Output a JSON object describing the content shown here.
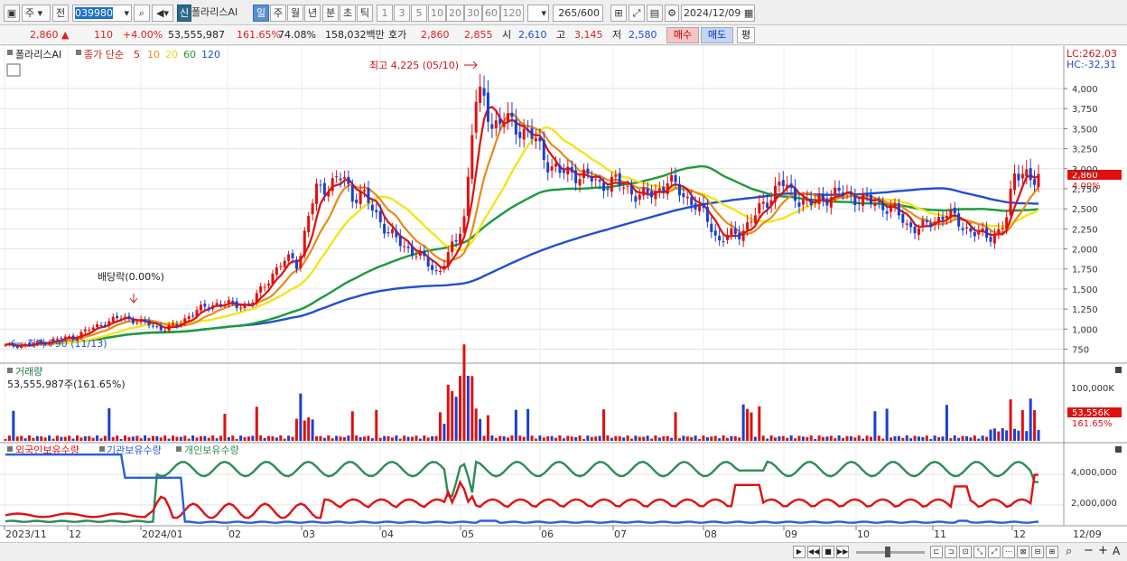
{
  "toolbar": {
    "market": "주",
    "prev_label": "전",
    "code": "039980",
    "new_label": "신",
    "name": "폴라리스AI",
    "periods": [
      "일",
      "주",
      "월",
      "년",
      "분",
      "초",
      "틱"
    ],
    "active_period": "일",
    "intervals": [
      "1",
      "3",
      "5",
      "10",
      "20",
      "30",
      "60",
      "120"
    ],
    "count": "265",
    "count_max": "/600",
    "date": "2024/12/09"
  },
  "quote": {
    "price": "2,860",
    "change": "110",
    "change_pct": "+4.00%",
    "volume": "53,555,987",
    "volume_ratio": "161.65%",
    "turnover_pct": "74.08%",
    "amount": "158,032백만",
    "bid_label": "호가",
    "ask": "2,860",
    "bid": "2,855",
    "open_label": "시",
    "open": "2,610",
    "high_label": "고",
    "high": "3,145",
    "low_label": "저",
    "low": "2,580",
    "buy_label": "매수",
    "sell_label": "매도",
    "flat_label": "평"
  },
  "price_panel": {
    "stock_label": "폴라리스AI",
    "ma_title": "종가 단순",
    "ma_periods": [
      "5",
      "10",
      "20",
      "60",
      "120"
    ],
    "lc": "LC:262,03",
    "hc": "HC:-32,31",
    "max_label": "최고 4,225 (05/10)",
    "min_label": "최저 790 (11/13)",
    "dividend_label": "배당락(0.00%)",
    "current_price_tag": "2,860",
    "current_pct_tag": "4.00%"
  },
  "volume_panel": {
    "title": "거래량",
    "value": "53,555,987주(161.65%)",
    "axis_label": "100,000K",
    "tag": "53,556K",
    "tag_pct": "161.65%"
  },
  "holding_panel": {
    "legend": [
      "외국인보유수량",
      "기관보유수량",
      "개인보유수량"
    ],
    "colors": [
      "#e01010",
      "#2a5fd6",
      "#2e8b57"
    ]
  },
  "xaxis": {
    "labels": [
      "2023/11",
      "12",
      "2024/01",
      "02",
      "03",
      "04",
      "05",
      "06",
      "07",
      "08",
      "09",
      "10",
      "11",
      "12"
    ],
    "end_label": "12/09"
  },
  "chart_data": {
    "type": "candlestick",
    "y_ticks": [
      4000,
      3750,
      3500,
      3250,
      3000,
      2750,
      2500,
      2250,
      2000,
      1750,
      1500,
      1250,
      1000,
      750
    ],
    "ylim": [
      620,
      4350
    ],
    "holding_ticks": [
      "4,000,000",
      "2,000,000"
    ]
  }
}
